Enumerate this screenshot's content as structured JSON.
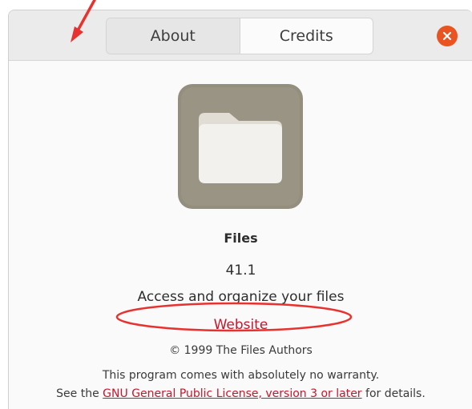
{
  "window": {
    "tabs": [
      {
        "label": "About",
        "active": false
      },
      {
        "label": "Credits",
        "active": true
      }
    ],
    "close_icon": "close-icon"
  },
  "about": {
    "app_icon": "folder-icon",
    "app_name": "Files",
    "version": "41.1",
    "description": "Access and organize your files",
    "website_label": "Website",
    "copyright": "© 1999 The Files Authors",
    "license_line1": "This program comes with absolutely no warranty.",
    "license_prefix": "See the ",
    "license_link": "GNU General Public License, version 3 or later",
    "license_suffix": " for details."
  },
  "colors": {
    "accent": "#e95420",
    "link": "#c7162b",
    "annotation": "#e8322f",
    "icon_bg": "#948e7f",
    "folder": "#f3f1ee"
  }
}
